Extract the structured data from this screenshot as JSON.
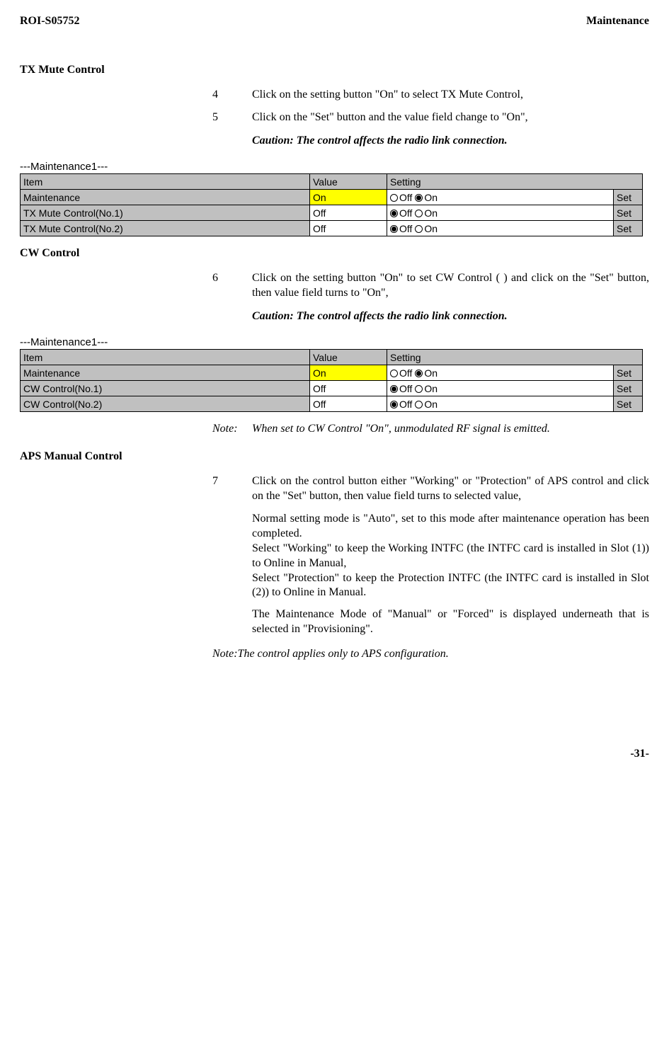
{
  "header": {
    "doc_id": "ROI-S05752",
    "section": "Maintenance"
  },
  "tx_mute": {
    "heading": "TX Mute Control",
    "steps": [
      {
        "num": "4",
        "text": "Click on the setting button \"On\" to select TX Mute Control,"
      },
      {
        "num": "5",
        "text": "Click on the \"Set\" button and the value field change to \"On\","
      }
    ],
    "caution": "Caution: The control affects the radio link connection."
  },
  "cw": {
    "heading": "CW Control",
    "steps": [
      {
        "num": "6",
        "text": "Click on the setting button \"On\" to set CW Control ( ) and click on the \"Set\" button, then value field turns to \"On\","
      }
    ],
    "caution": "Caution: The control affects the radio link connection.",
    "note_label": "Note:",
    "note_text": "When set to CW Control \"On\", unmodulated RF signal is emitted."
  },
  "aps": {
    "heading": "APS Manual Control",
    "steps": [
      {
        "num": "7",
        "text": "Click on the control button either \"Working\" or \"Protection\" of APS control and click on the \"Set\" button, then value field turns to selected value,"
      }
    ],
    "para1": "Normal setting mode is \"Auto\", set to this mode after maintenance operation has been completed.",
    "para2": "Select \"Working\" to keep the Working INTFC (the INTFC card is installed in Slot (1)) to Online in Manual,",
    "para3": "Select \"Protection\" to keep the Protection INTFC (the INTFC card is installed in Slot (2)) to Online in Manual.",
    "para4": "The Maintenance Mode of \"Manual\" or \"Forced\" is displayed underneath that is selected in \"Provisioning\".",
    "note": "Note:The control applies only to APS configuration."
  },
  "table1": {
    "title": "---Maintenance1---",
    "headers": {
      "item": "Item",
      "value": "Value",
      "setting": "Setting"
    },
    "rows": [
      {
        "item": "Maintenance",
        "value": "On",
        "value_on": true,
        "off_filled": false,
        "on_filled": true,
        "off_label": "Off",
        "on_label": "On",
        "set": "Set"
      },
      {
        "item": "TX Mute Control(No.1)",
        "value": "Off",
        "value_on": false,
        "off_filled": true,
        "on_filled": false,
        "off_label": "Off",
        "on_label": "On",
        "set": "Set"
      },
      {
        "item": "TX Mute Control(No.2)",
        "value": "Off",
        "value_on": false,
        "off_filled": true,
        "on_filled": false,
        "off_label": "Off",
        "on_label": "On",
        "set": "Set"
      }
    ]
  },
  "table2": {
    "title": "---Maintenance1---",
    "headers": {
      "item": "Item",
      "value": "Value",
      "setting": "Setting"
    },
    "rows": [
      {
        "item": "Maintenance",
        "value": "On",
        "value_on": true,
        "off_filled": false,
        "on_filled": true,
        "off_label": "Off",
        "on_label": "On",
        "set": "Set"
      },
      {
        "item": "CW Control(No.1)",
        "value": "Off",
        "value_on": false,
        "off_filled": true,
        "on_filled": false,
        "off_label": "Off",
        "on_label": "On",
        "set": "Set"
      },
      {
        "item": "CW Control(No.2)",
        "value": "Off",
        "value_on": false,
        "off_filled": true,
        "on_filled": false,
        "off_label": "Off",
        "on_label": "On",
        "set": "Set"
      }
    ]
  },
  "page_num": "-31-"
}
